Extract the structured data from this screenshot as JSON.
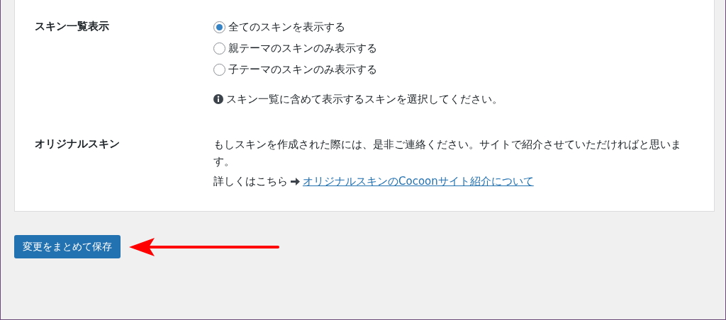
{
  "settings": [
    {
      "label": "スキン一覧表示",
      "kind": "radio",
      "options": [
        {
          "label": "全てのスキンを表示する",
          "selected": true
        },
        {
          "label": "親テーマのスキンのみ表示する",
          "selected": false
        },
        {
          "label": "子テーマのスキンのみ表示する",
          "selected": false
        }
      ],
      "note": "スキン一覧に含めて表示するスキンを選択してください。"
    },
    {
      "label": "オリジナルスキン",
      "kind": "text",
      "paragraph": "もしスキンを作成された際には、是非ご連絡ください。サイトで紹介させていただければと思います。",
      "link_prefix": "詳しくはこちら",
      "link": "オリジナルスキンのCocoonサイト紹介について"
    }
  ],
  "save_button": "変更をまとめて保存"
}
